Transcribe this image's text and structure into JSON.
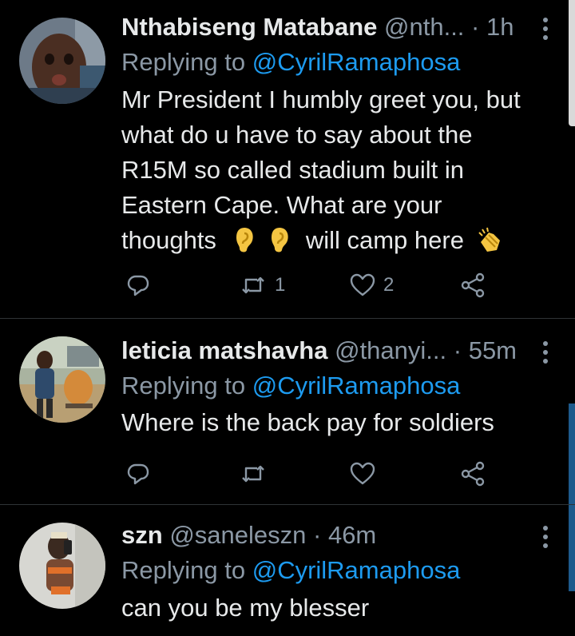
{
  "tweets": [
    {
      "name": "Nthabiseng Matabane",
      "handle": "@nth...",
      "time": "1h",
      "replying_prefix": "Replying to",
      "replying_to": "@CyrilRamaphosa",
      "lines": [
        "Mr President I humbly greet you, but",
        "what do u have to say about the",
        "R15M so called stadium built in",
        "Eastern Cape. What are your"
      ],
      "last_line_start": "thoughts",
      "last_line_mid": "will camp here",
      "emojis": [
        "ear-emoji",
        "ear-emoji",
        "clapping-hands-emoji"
      ],
      "retweets": "1",
      "likes": "2"
    },
    {
      "name": "leticia matshavha",
      "handle": "@thanyi...",
      "time": "55m",
      "replying_prefix": "Replying to",
      "replying_to": "@CyrilRamaphosa",
      "text": "Where is the back pay for soldiers",
      "retweets": "",
      "likes": ""
    },
    {
      "name": "szn",
      "handle": "@saneleszn",
      "time": "46m",
      "replying_prefix": "Replying to",
      "replying_to": "@CyrilRamaphosa",
      "text": "can you be my blesser"
    }
  ],
  "separator": "·",
  "icons": {
    "reply": "reply-icon",
    "retweet": "retweet-icon",
    "like": "heart-icon",
    "share": "share-icon",
    "more": "more-vertical-icon"
  },
  "colors": {
    "background": "#000000",
    "text": "#e7e9ea",
    "muted": "#8b98a5",
    "link": "#1d9bf0",
    "divider": "#2f3336"
  }
}
